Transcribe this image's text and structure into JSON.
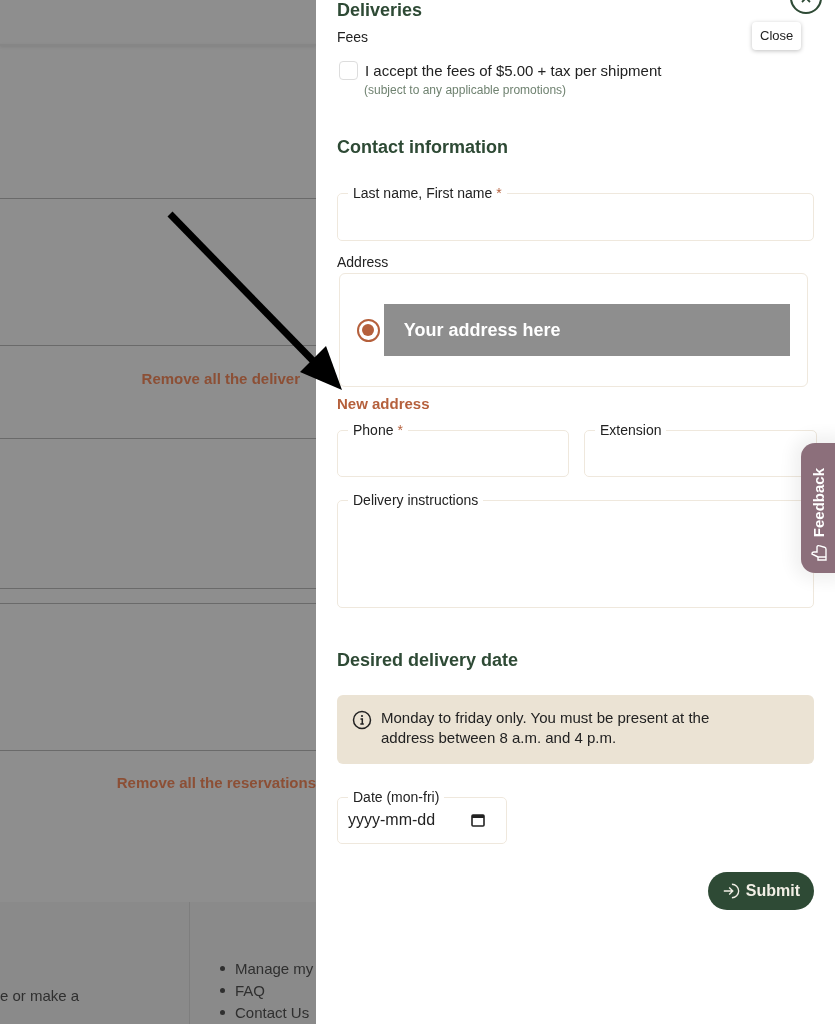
{
  "backdrop": {
    "links": [
      {
        "text": "Remove all the deliver"
      },
      {
        "text": "Remove all the reservations"
      }
    ],
    "footer_text": "e or make a",
    "footer_links": [
      "Manage my",
      "FAQ",
      "Contact Us"
    ]
  },
  "panel": {
    "title": "Deliveries",
    "close_tooltip": "Close",
    "fees": {
      "label": "Fees",
      "checkbox": {
        "label": "I accept the fees of $5.00 + tax per shipment",
        "checked": false
      },
      "note": "(subject to any applicable promotions)"
    },
    "contact_heading": "Contact information",
    "name_field": {
      "label": "Last name, First name",
      "required_mark": "*"
    },
    "address": {
      "label": "Address",
      "options": [
        {
          "text": "Your address here",
          "selected": true
        }
      ],
      "new_address_link": "New address"
    },
    "phone_field": {
      "label": "Phone",
      "required_mark": "*"
    },
    "extension_field": {
      "label": "Extension"
    },
    "instructions_field": {
      "label": "Delivery instructions"
    },
    "date_heading": "Desired delivery date",
    "info": "Monday to friday only. You must be present at the address between 8 a.m. and 4 p.m.",
    "date_field": {
      "label": "Date (mon-fri)",
      "placeholder": "yyyy-mm-dd"
    },
    "submit": "Submit"
  },
  "feedback_tab": "Feedback"
}
